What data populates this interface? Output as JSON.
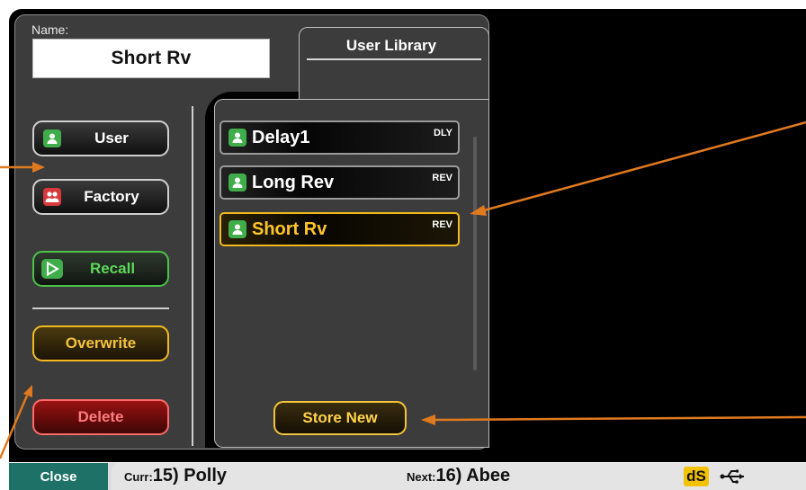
{
  "name_field": {
    "label": "Name:",
    "value": "Short Rv"
  },
  "library": {
    "title": "User Library",
    "items": [
      {
        "name": "Delay1",
        "tag": "DLY",
        "selected": false
      },
      {
        "name": "Long Rev",
        "tag": "REV",
        "selected": false
      },
      {
        "name": "Short Rv",
        "tag": "REV",
        "selected": true
      }
    ],
    "store_new_label": "Store New"
  },
  "buttons": {
    "user": "User",
    "factory": "Factory",
    "recall": "Recall",
    "overwrite": "Overwrite",
    "delete": "Delete"
  },
  "status_bar": {
    "close": "Close",
    "curr_prefix": "Curr:",
    "curr_value": "15) Polly",
    "next_prefix": "Next:",
    "next_value": "16) Abee",
    "ds_badge": "dS"
  },
  "colors": {
    "accent_yellow": "#f2b91e",
    "recall_green": "#4cc24a",
    "delete_red": "#d8393c",
    "close_teal": "#1e7166",
    "annotation_arrow": "#e07a1f"
  }
}
